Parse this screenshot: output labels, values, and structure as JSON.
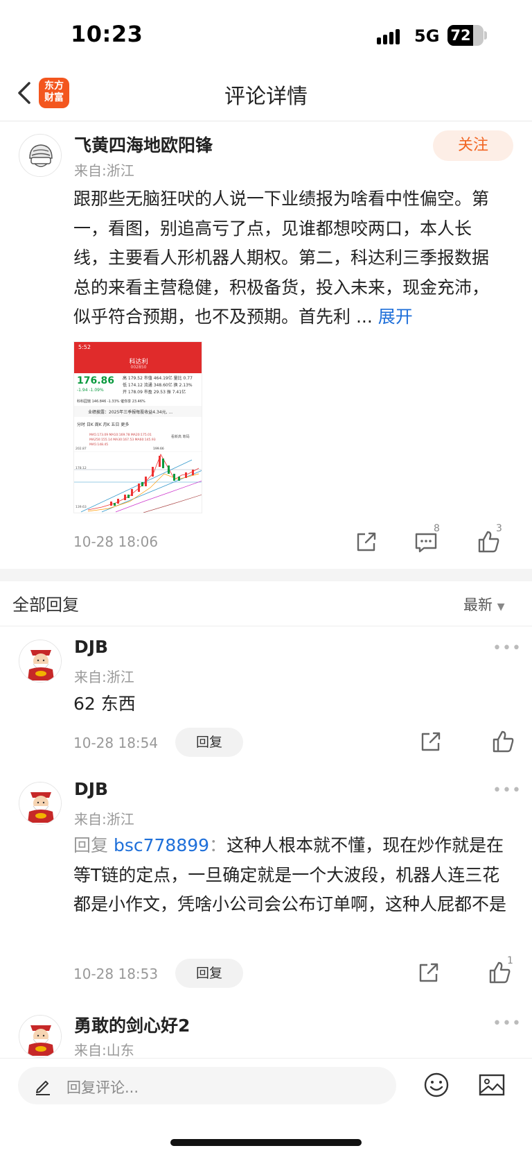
{
  "status_bar": {
    "time": "10:23",
    "network": "5G",
    "battery": "72"
  },
  "nav": {
    "logo": "东方\n财富",
    "title": "评论详情"
  },
  "post": {
    "author": "飞黄四海地欧阳锋",
    "from": "来自:浙江",
    "follow_label": "关注",
    "body": "跟那些无脑狂吠的人说一下业绩报为啥看中性偏空。第一，看图，别追高亏了点，见谁都想咬两口，本人长线，主要看人形机器人期权。第二，科达利三季报数据总的来看主营稳健，积极备货，投入未来，现金充沛，似乎符合预期，也不及预期。首先利 ...",
    "expand_label": "展开",
    "time": "10-28 18:06",
    "comment_count": "8",
    "like_count": "3",
    "stock": {
      "app_time": "5:52",
      "name": "科达利",
      "code": "002850",
      "price": "176.86",
      "change": "-1.94",
      "change_pct": "-1.09%",
      "row1": [
        "高",
        "179.52",
        "市值",
        "464.19亿",
        "量比",
        "0.77"
      ],
      "row2": [
        "低",
        "174.12",
        "流通",
        "348.60亿",
        "换",
        "2.13%"
      ],
      "row3": [
        "开",
        "178.09",
        "市盈",
        "29.53",
        "振",
        "7.41亿"
      ],
      "sub": [
        "科科园馆",
        "146.846",
        "-1.33%",
        "催你享",
        "23.46%"
      ],
      "news": "业绩披露：2025年三季报每股收益4.34元, ...",
      "tabs": [
        "分时",
        "日K",
        "周K",
        "月K",
        "五日",
        "更多"
      ],
      "ma_line": "MA5:173.09  MA10:169.78  MA20:175.01",
      "ma_line2": "MA250:155.14  MA30:167.53  MA60:145.93",
      "ma_line3": "MA5:148.45",
      "high_label": "199.66",
      "price_labels": [
        "202.87",
        "178.12",
        "139.63"
      ],
      "right_labels": [
        "看新高",
        "筹码"
      ]
    }
  },
  "replies_header": {
    "title": "全部回复",
    "sort_label": "最新"
  },
  "replies": [
    {
      "name": "DJB",
      "from": "来自:浙江",
      "text": "62 东西",
      "time": "10-28 18:54",
      "reply_label": "回复",
      "likes": ""
    },
    {
      "name": "DJB",
      "from": "来自:浙江",
      "reply_prefix": "回复",
      "mention": "bsc778899",
      "colon": "：",
      "text": "这种人根本就不懂，现在炒作就是在等T链的定点，一旦确定就是一个大波段，机器人连三花都是小作文，凭啥小公司会公布订单啊，这种人屁都不是",
      "time": "10-28 18:53",
      "reply_label": "回复",
      "likes": "1"
    },
    {
      "name": "勇敢的剑心好2",
      "from": "来自:山东"
    }
  ],
  "bottom": {
    "placeholder": "回复评论..."
  }
}
